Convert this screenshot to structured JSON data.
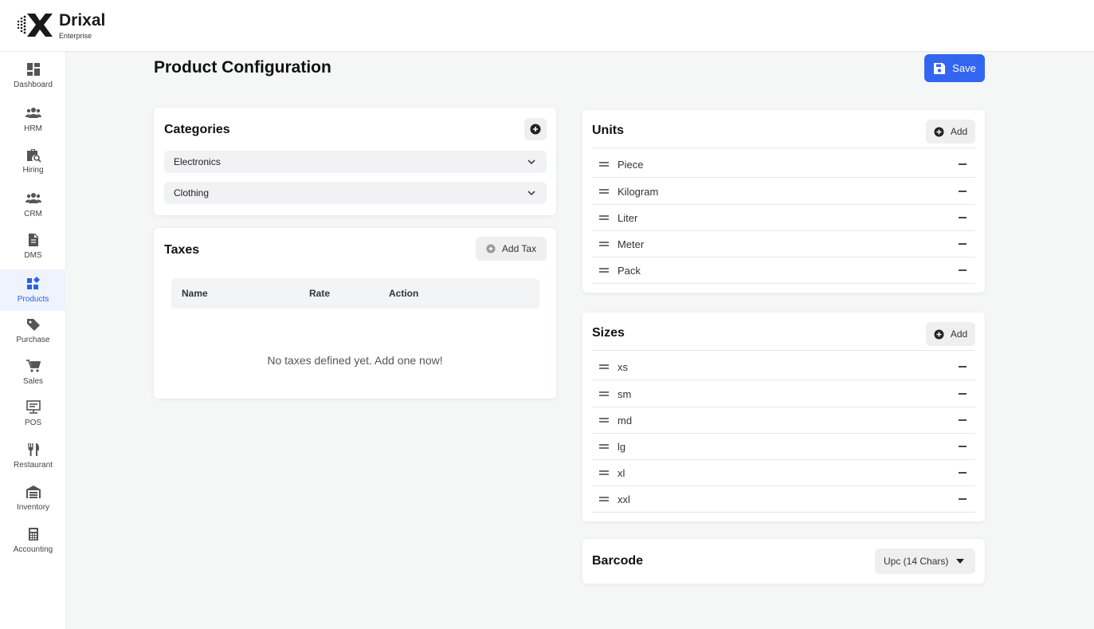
{
  "brand": {
    "name": "Drixal",
    "tagline": "Enterprise"
  },
  "sidebar": {
    "items": [
      {
        "label": "Dashboard",
        "icon": "dashboard-icon"
      },
      {
        "label": "HRM",
        "icon": "people-icon"
      },
      {
        "label": "Hiring",
        "icon": "briefcase-search-icon"
      },
      {
        "label": "CRM",
        "icon": "group-icon"
      },
      {
        "label": "DMS",
        "icon": "document-icon"
      },
      {
        "label": "Products",
        "icon": "widgets-icon",
        "active": true
      },
      {
        "label": "Purchase",
        "icon": "tag-icon"
      },
      {
        "label": "Sales",
        "icon": "cart-icon"
      },
      {
        "label": "POS",
        "icon": "pos-terminal-icon"
      },
      {
        "label": "Restaurant",
        "icon": "utensils-icon"
      },
      {
        "label": "Inventory",
        "icon": "warehouse-icon"
      },
      {
        "label": "Accounting",
        "icon": "calculator-icon"
      }
    ]
  },
  "page": {
    "title": "Product Configuration",
    "save_label": "Save"
  },
  "categories": {
    "title": "Categories",
    "items": [
      "Electronics",
      "Clothing"
    ]
  },
  "taxes": {
    "title": "Taxes",
    "add_label": "Add Tax",
    "columns": [
      "Name",
      "Rate",
      "Action"
    ],
    "empty_message": "No taxes defined yet. Add one now!"
  },
  "units": {
    "title": "Units",
    "add_label": "Add",
    "items": [
      "Piece",
      "Kilogram",
      "Liter",
      "Meter",
      "Pack"
    ]
  },
  "sizes": {
    "title": "Sizes",
    "add_label": "Add",
    "items": [
      "xs",
      "sm",
      "md",
      "lg",
      "xl",
      "xxl"
    ]
  },
  "barcode": {
    "title": "Barcode",
    "selected": "Upc (14 Chars)"
  },
  "colors": {
    "accent": "#3366f0",
    "active_nav": "#2b61e6"
  }
}
